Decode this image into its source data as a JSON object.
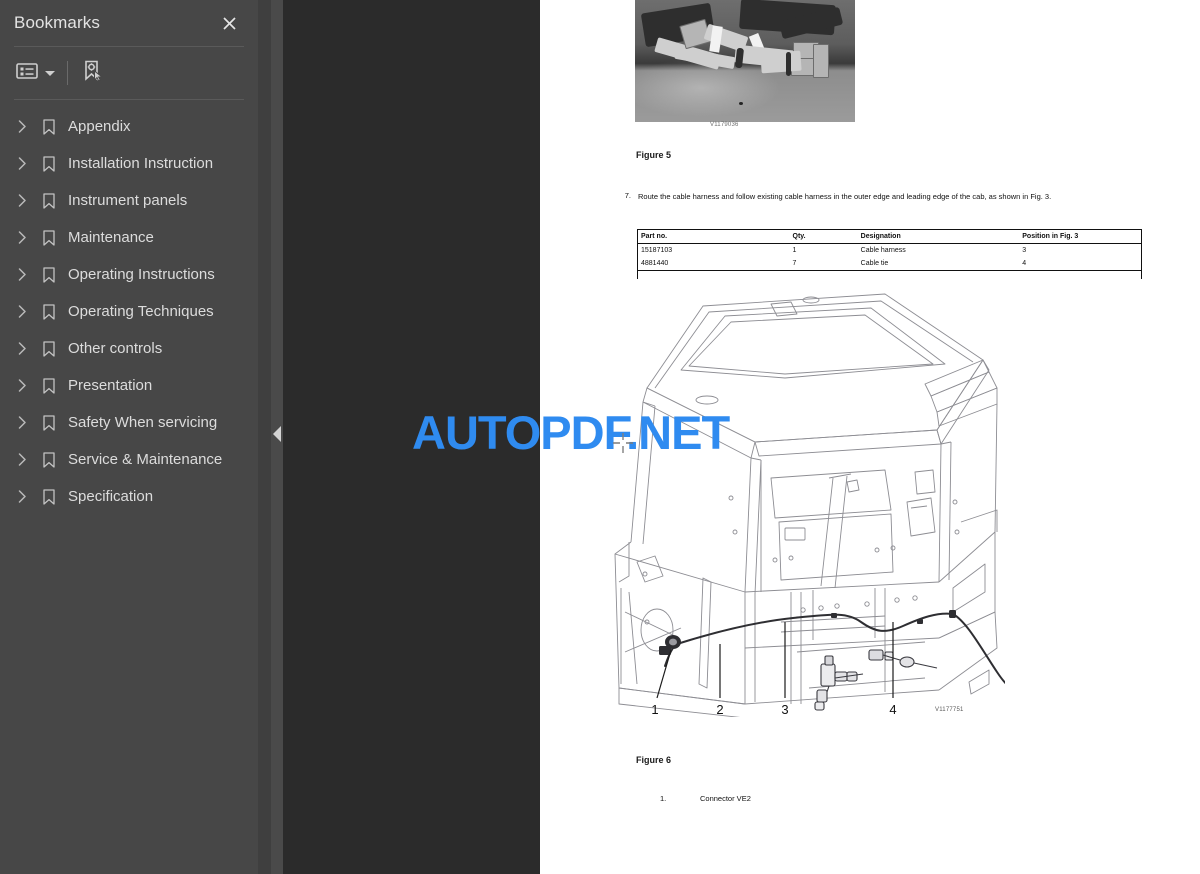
{
  "sidebar": {
    "title": "Bookmarks",
    "close_label": "✕",
    "toolbar": {
      "options_icon": "list-options-icon",
      "options_caret": "chevron-down-icon",
      "new_bookmark_icon": "new-bookmark-icon"
    },
    "items": [
      {
        "label": "Appendix"
      },
      {
        "label": "Installation Instruction"
      },
      {
        "label": "Instrument panels"
      },
      {
        "label": "Maintenance"
      },
      {
        "label": "Operating Instructions"
      },
      {
        "label": "Operating Techniques"
      },
      {
        "label": "Other controls"
      },
      {
        "label": "Presentation"
      },
      {
        "label": "Safety When servicing"
      },
      {
        "label": "Service & Maintenance"
      },
      {
        "label": "Specification"
      }
    ]
  },
  "collapse_handle": {
    "icon": "triangle-left-icon"
  },
  "document": {
    "figure5": {
      "caption": "Figure 5",
      "image_code": "V1179036",
      "alt": "photo-of-cable-harness-connectors"
    },
    "step": {
      "number": "7.",
      "text": "Route the cable harness and follow existing cable harness in the outer edge and leading edge of the cab, as shown in Fig. 3."
    },
    "parts_table": {
      "headers": [
        "Part no.",
        "Qty.",
        "Designation",
        "Position in Fig. 3"
      ],
      "rows": [
        [
          "15187103",
          "1",
          "Cable harness",
          "3"
        ],
        [
          "4881440",
          "7",
          "Cable tie",
          "4"
        ]
      ]
    },
    "figure6": {
      "caption": "Figure 6",
      "image_code": "V1177751",
      "alt": "line-drawing-of-cab-frame-with-cable-harness",
      "callouts": [
        "1",
        "2",
        "3",
        "4"
      ],
      "legend": [
        {
          "num": "1.",
          "text": "Connector VE2"
        }
      ]
    }
  },
  "watermark": {
    "text": "AUTOPDF.NET",
    "color": "#2f8bf0"
  },
  "colors": {
    "panel_bg": "#474747",
    "viewer_bg": "#2b2b2b",
    "page_bg": "#ffffff",
    "accent": "#2f8bf0"
  }
}
